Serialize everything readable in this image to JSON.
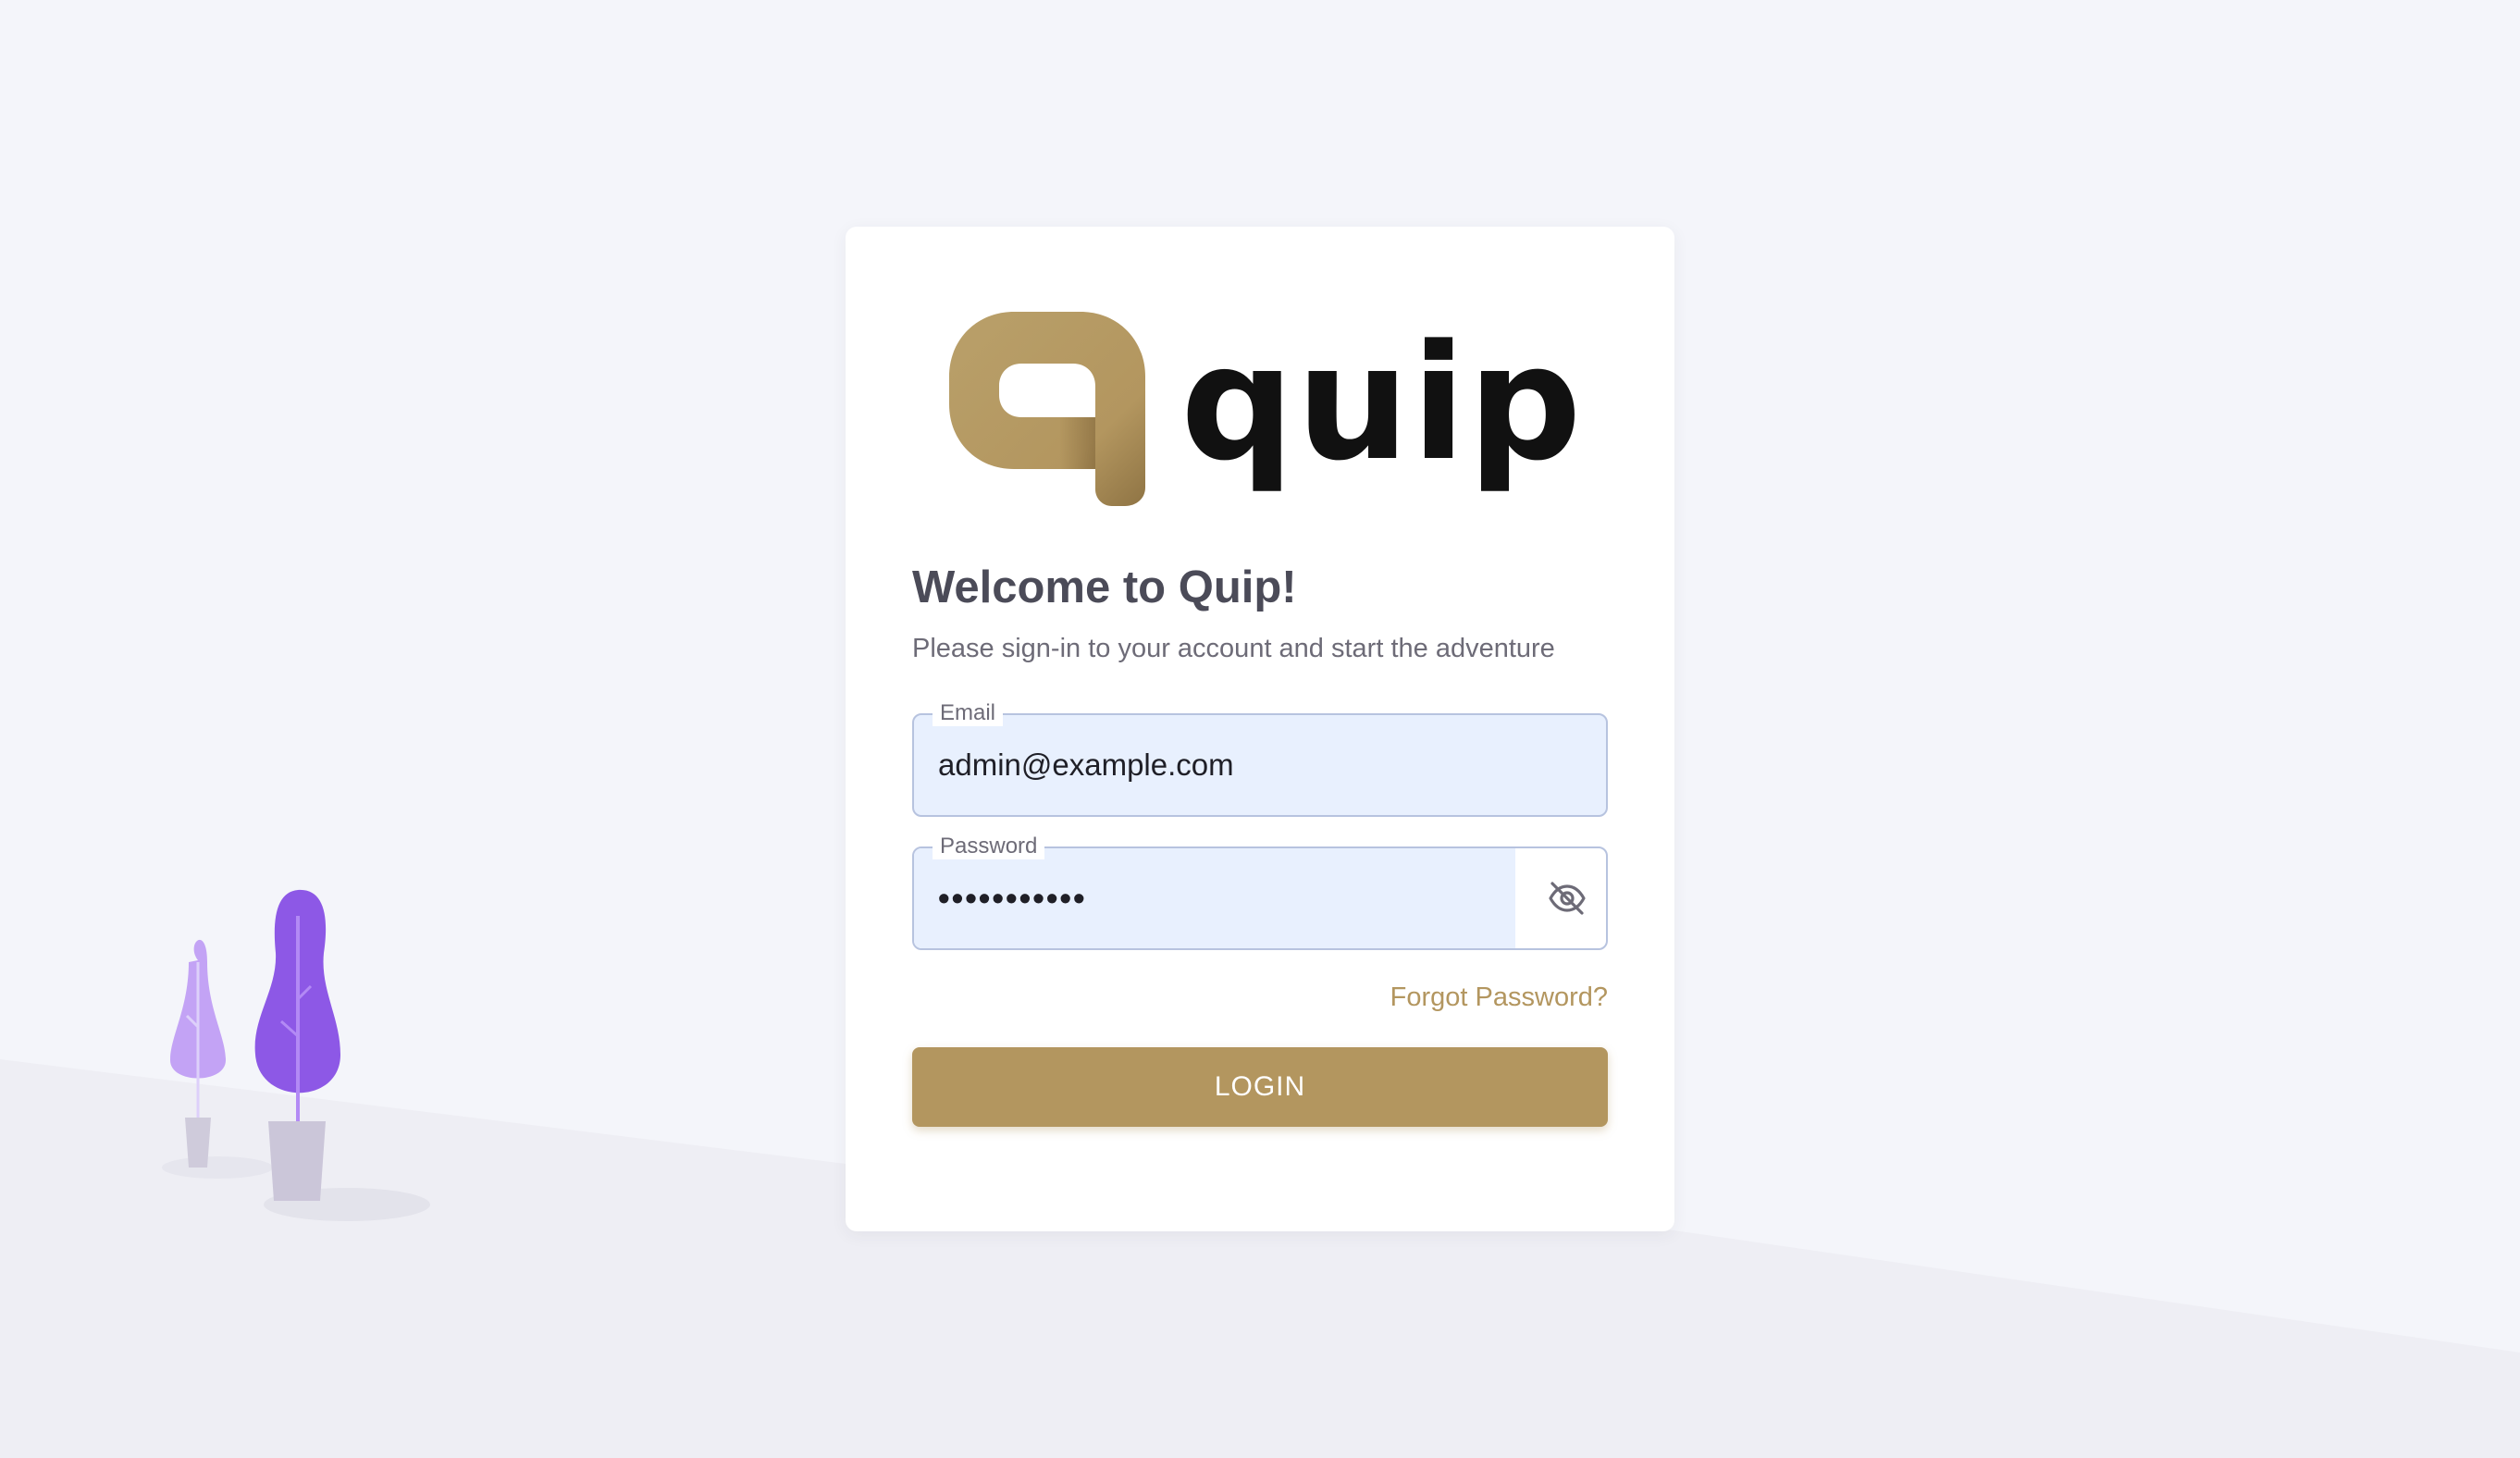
{
  "brand": {
    "name": "quip",
    "color": "#b3965f"
  },
  "welcome": {
    "title": "Welcome to Quip!",
    "subtitle": "Please sign-in to your account and start the adventure"
  },
  "form": {
    "email": {
      "label": "Email",
      "value": "admin@example.com"
    },
    "password": {
      "label": "Password",
      "masked_value": "•••••••••••",
      "toggle_icon": "eye-off-icon"
    },
    "forgot_label": "Forgot Password?",
    "login_label": "LOGIN"
  }
}
